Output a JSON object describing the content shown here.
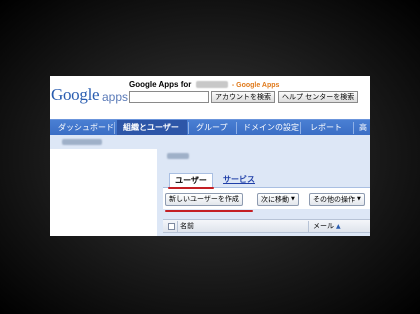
{
  "header": {
    "logo_google": "Google",
    "logo_apps": "apps",
    "title_prefix": "Google Apps for",
    "title_brand": "- Google Apps",
    "search_apps_button": "アカウントを検索",
    "search_help_button": "ヘルプ センターを検索"
  },
  "nav": {
    "items": [
      "ダッシュボード",
      "組織とユーザー",
      "グループ",
      "ドメインの設定",
      "レポート",
      "高"
    ],
    "active_index": 1
  },
  "tabs": {
    "active": "ユーザー",
    "other": "サービス"
  },
  "toolbar": {
    "create_user": "新しいユーザーを作成",
    "move_to": "次に移動",
    "other_actions": "その他の操作"
  },
  "table": {
    "col_name": "名前",
    "col_mail": "メール"
  },
  "colors": {
    "nav_bg": "#3b6ec5",
    "nav_active": "#2d56a8",
    "highlight_underline": "#c41f24",
    "pane_bg": "#dde7f6",
    "link": "#1f3fa8"
  }
}
